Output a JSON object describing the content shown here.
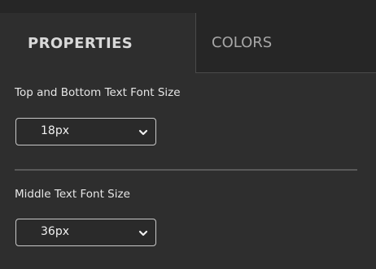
{
  "tabs": {
    "properties": "PROPERTIES",
    "colors": "COLORS"
  },
  "top_bottom_font": {
    "label": "Top and Bottom Text Font Size",
    "value": "18px"
  },
  "middle_font": {
    "label": "Middle Text Font Size",
    "value": "36px"
  },
  "colors": {
    "panel_background": "#2e2e2e",
    "tab_bar_background": "#262626",
    "active_tab_text": "#d9d9d9",
    "inactive_tab_text": "#a7a7a7",
    "divider": "#595959"
  },
  "icons": {
    "dropdown": "chevron-down-icon"
  }
}
